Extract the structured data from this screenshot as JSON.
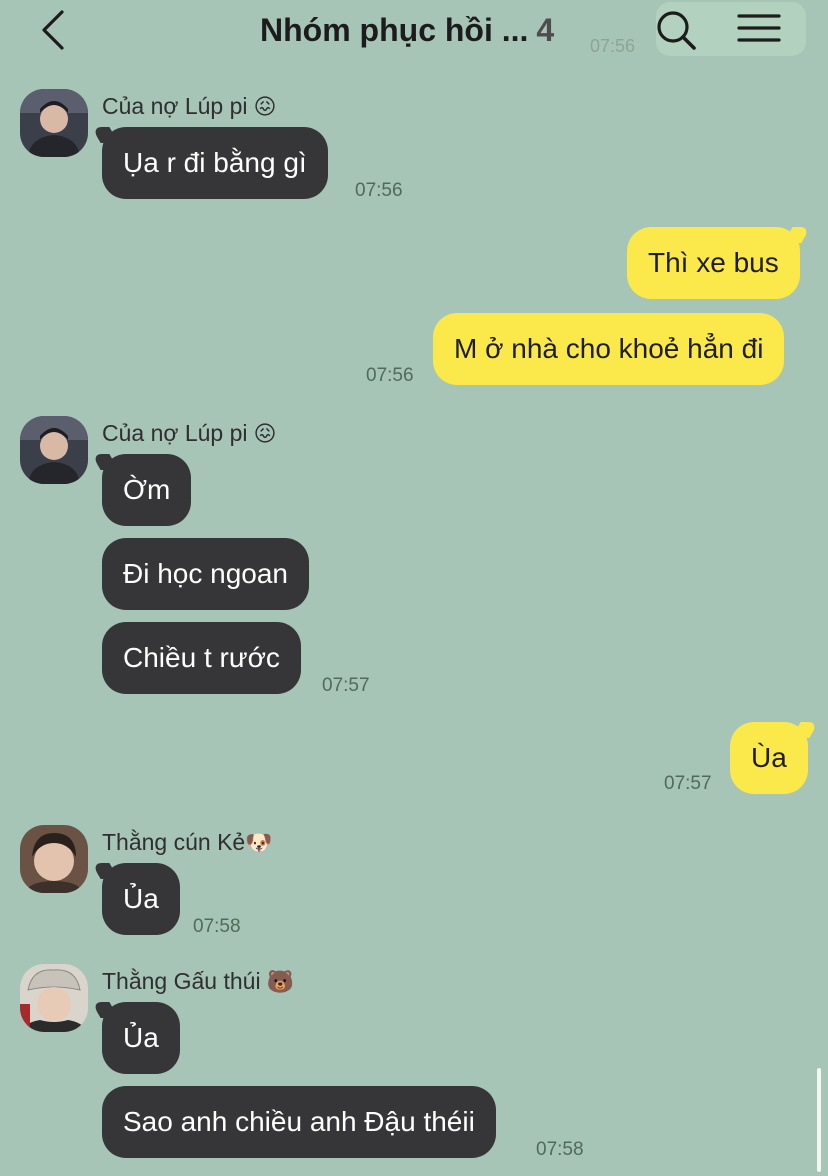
{
  "header": {
    "title": "Nhóm phục hồi ...",
    "member_count": "4",
    "ghost_time": "07:56",
    "back_icon": "chevron-left-icon",
    "search_icon": "search-icon",
    "menu_icon": "hamburger-menu-icon"
  },
  "colors": {
    "background": "#a6c5b6",
    "incoming_bubble": "#363638",
    "outgoing_bubble": "#fbe84a"
  },
  "messages": [
    {
      "sender": "Của nợ Lúp pi",
      "sender_emoji": "😖",
      "text": "Ụa r đi bằng gì",
      "time": "07:56",
      "direction": "in"
    },
    {
      "text": "Thì xe bus",
      "direction": "out"
    },
    {
      "text": "M ở nhà cho khoẻ hẳn đi",
      "time": "07:56",
      "direction": "out"
    },
    {
      "sender": "Của nợ Lúp pi",
      "sender_emoji": "😖",
      "text": "Ờm",
      "direction": "in"
    },
    {
      "text": "Đi học ngoan",
      "direction": "in"
    },
    {
      "text": "Chiều t rước",
      "time": "07:57",
      "direction": "in"
    },
    {
      "text": "Ùa",
      "time": "07:57",
      "direction": "out"
    },
    {
      "sender": "Thằng cún Kẻ",
      "sender_emoji": "🐶",
      "text": "Ủa",
      "time": "07:58",
      "direction": "in"
    },
    {
      "sender": "Thằng Gấu thúi",
      "sender_emoji": "🐻",
      "text": "Ủa",
      "direction": "in"
    },
    {
      "text": "Sao anh chiều anh Đậu théii",
      "time": "07:58",
      "direction": "in"
    }
  ]
}
